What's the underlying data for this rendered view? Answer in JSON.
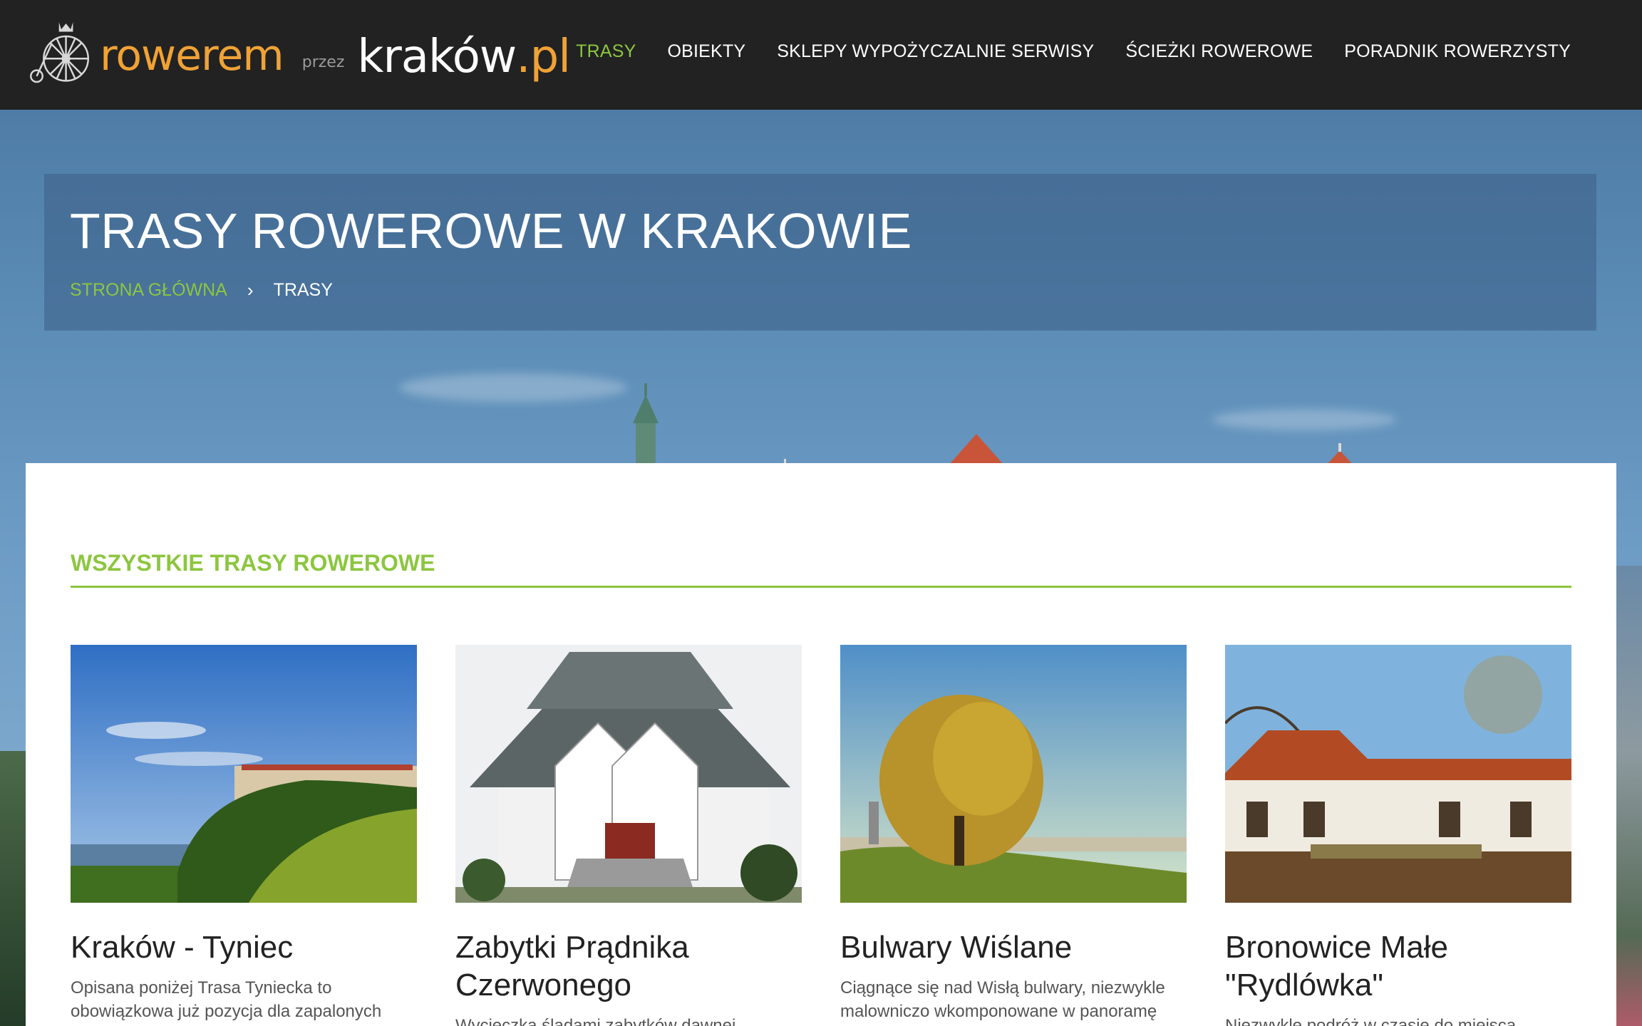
{
  "header": {
    "logo": {
      "part1": "rowerem",
      "part2": "przez",
      "part3": "kraków",
      "part4": ".pl"
    },
    "nav": [
      {
        "label": "TRASY",
        "active": true
      },
      {
        "label": "OBIEKTY",
        "active": false
      },
      {
        "label": "SKLEPY WYPOŻYCZALNIE SERWISY",
        "active": false
      },
      {
        "label": "ŚCIEŻKI ROWEROWE",
        "active": false
      },
      {
        "label": "PORADNIK ROWERZYSTY",
        "active": false
      }
    ]
  },
  "hero": {
    "title": "TRASY ROWEROWE W KRAKOWIE",
    "breadcrumb": {
      "home": "STRONA GŁÓWNA",
      "separator": "›",
      "current": "TRASY"
    }
  },
  "section": {
    "title": "WSZYSTKIE TRASY ROWEROWE"
  },
  "cards": [
    {
      "title": "Kraków - Tyniec",
      "desc": "Opisana poniżej Trasa Tyniecka to obowiązkowa już pozycja dla zapalonych"
    },
    {
      "title": "Zabytki Prądnika Czerwonego",
      "desc": "Wycieczka śladami zabytków dawnej"
    },
    {
      "title": "Bulwary Wiślane",
      "desc": "Ciągnące się nad Wisłą bulwary, niezwykle malowniczo wkomponowane w panoramę"
    },
    {
      "title": "Bronowice Małe \"Rydlówka\"",
      "desc": "Niezwykle podróż w czasie do miejsca"
    }
  ],
  "colors": {
    "accent": "#8cc63f",
    "logo_orange": "#f0a236",
    "header_bg": "#222222"
  }
}
